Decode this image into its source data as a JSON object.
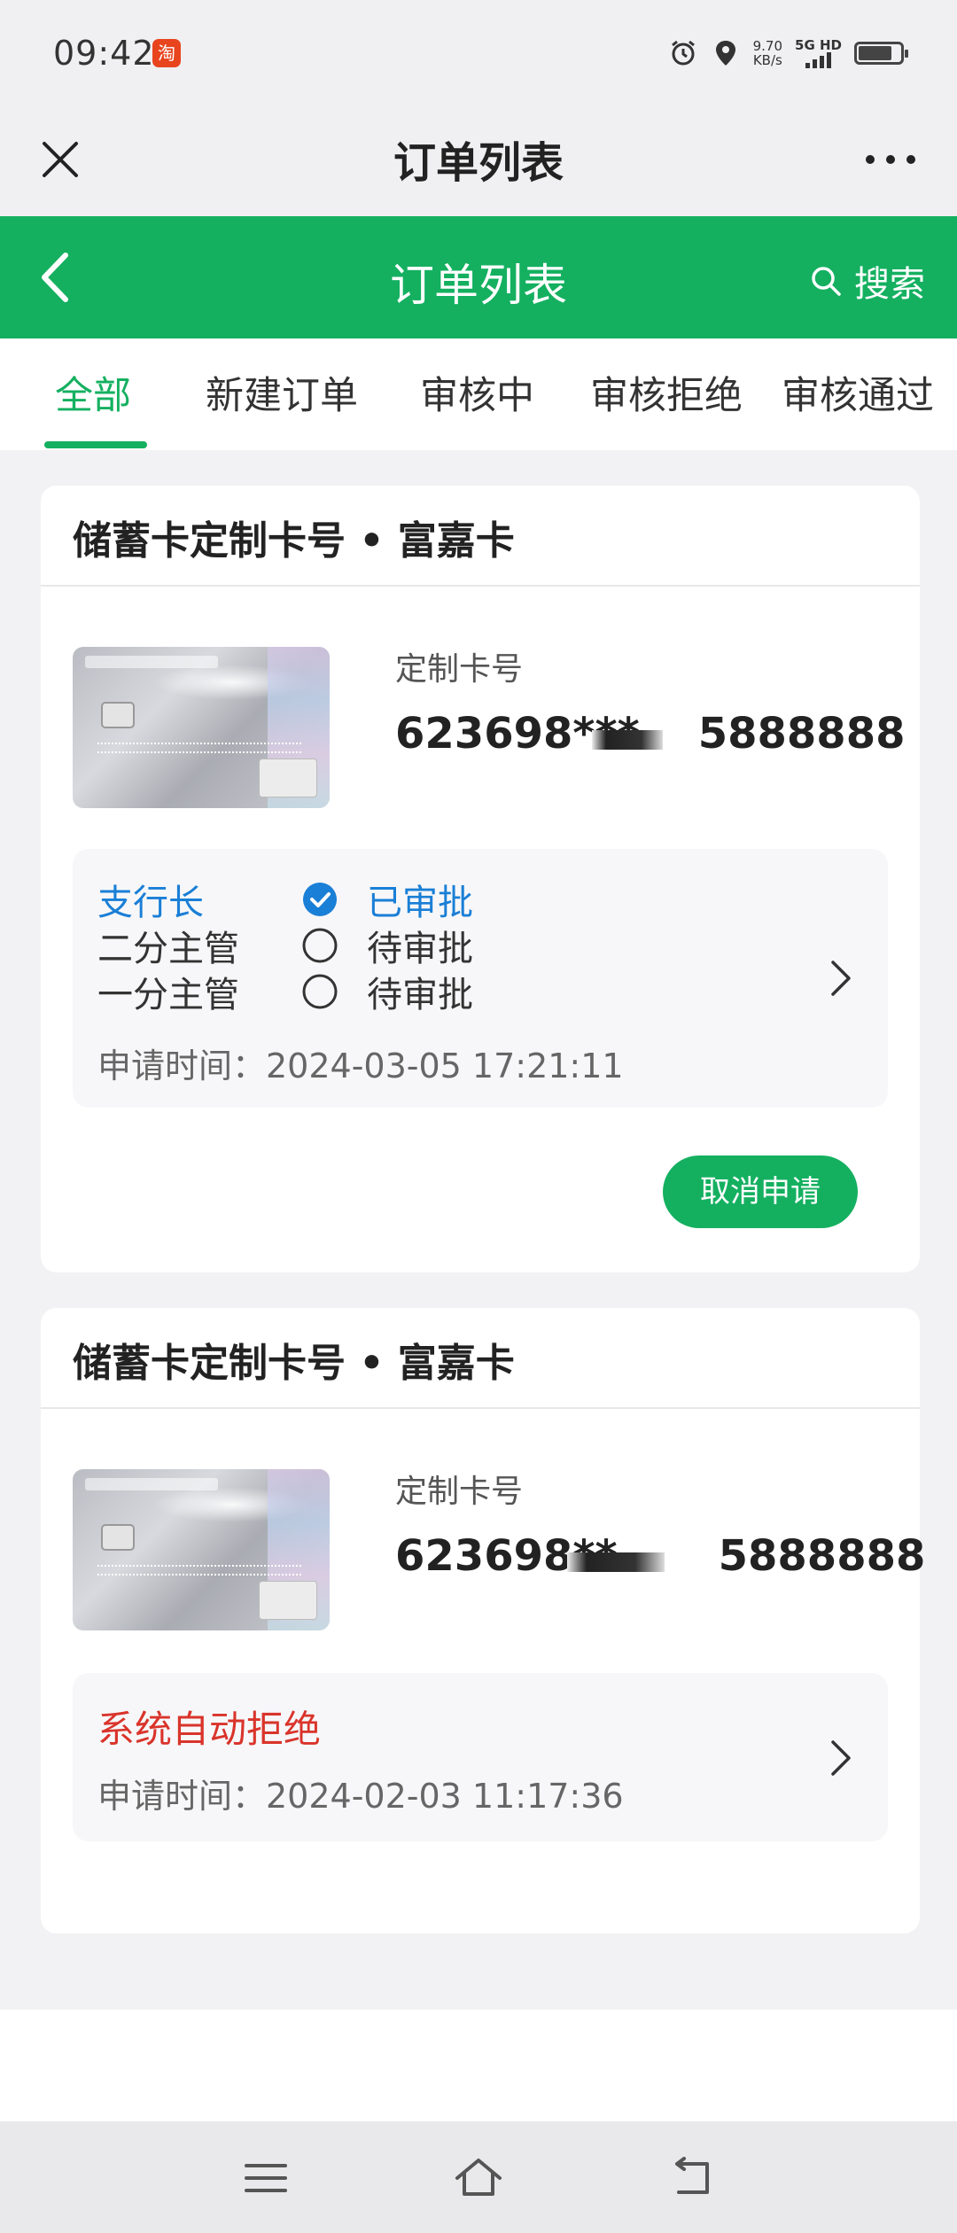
{
  "status_bar": {
    "time": "09:42",
    "net_speed_value": "9.70",
    "net_speed_unit": "KB/s",
    "network": "5G HD",
    "battery_level": 0.8
  },
  "topbar": {
    "title": "订单列表"
  },
  "header": {
    "title": "订单列表",
    "search_label": "搜索"
  },
  "tabs": [
    {
      "label": "全部",
      "active": true
    },
    {
      "label": "新建订单",
      "active": false
    },
    {
      "label": "审核中",
      "active": false
    },
    {
      "label": "审核拒绝",
      "active": false
    },
    {
      "label": "审核通过",
      "active": false
    }
  ],
  "orders": [
    {
      "title": "储蓄卡定制卡号 • 富嘉卡",
      "number_label": "定制卡号",
      "card_number_prefix": "623698***",
      "card_number_suffix": "5888888",
      "steps": [
        {
          "role": "支行长",
          "status": "已审批",
          "done": true
        },
        {
          "role": "二分主管",
          "status": "待审批",
          "done": false
        },
        {
          "role": "一分主管",
          "status": "待审批",
          "done": false
        }
      ],
      "apply_time": "申请时间：2024-03-05 17:21:11",
      "action_label": "取消申请"
    },
    {
      "title": "储蓄卡定制卡号 • 富嘉卡",
      "number_label": "定制卡号",
      "card_number_prefix": "623698**",
      "card_number_suffix": "5888888",
      "status_text": "系统自动拒绝",
      "apply_time": "申请时间：2024-02-03 11:17:36"
    }
  ],
  "colors": {
    "brand_green": "#14b060",
    "approved_blue": "#1a7fd6",
    "reject_red": "#d9342b"
  },
  "icons": [
    "close-icon",
    "more-icon",
    "back-icon",
    "search-icon",
    "check-circle-icon",
    "empty-circle-icon",
    "chevron-right-icon",
    "menu-icon",
    "home-icon",
    "back-nav-icon"
  ]
}
